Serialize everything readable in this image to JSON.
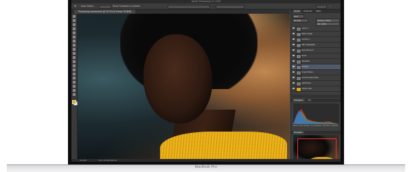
{
  "device": {
    "model_label": "MacBook Pro"
  },
  "window": {
    "title": "Adobe Photoshop CC 2018"
  },
  "document": {
    "tab_label": "Photoshop screenshot @ 33.3% (Portrait, RGB/8)"
  },
  "options_bar": {
    "tool_label": "Auto-Select",
    "select_value": "Layer",
    "transform_label": "Show Transform Controls"
  },
  "panels": {
    "tabs": [
      "Layers",
      "Channels",
      "Paths"
    ],
    "active_tab": "Layers",
    "kind_label": "Kind",
    "blend_mode": "Normal",
    "opacity_label": "Opacity: 100%",
    "fill_label": "Fill: 100%",
    "layers": [
      {
        "name": "Layer 1"
      },
      {
        "name": "Base Image"
      },
      {
        "name": "Curves 1"
      },
      {
        "name": "Skin Highlights"
      },
      {
        "name": "Hair Retouch"
      },
      {
        "name": "Hand"
      },
      {
        "name": "Shoulder"
      },
      {
        "name": "Portrait"
      },
      {
        "name": "Smart Filters"
      },
      {
        "name": "Camera Raw Filter"
      },
      {
        "name": "Add Noise"
      },
      {
        "name": "Yellow shirt"
      }
    ]
  },
  "histogram": {
    "tabs": [
      "Histogram",
      "Info"
    ],
    "stats": "Mean: 64.31  Std Dev: 51.22  Median: 48  Pixels: 1205760"
  },
  "navigator": {
    "tabs": [
      "Navigator"
    ]
  },
  "status": {
    "zoom": "33.33%",
    "doc_size": "Doc: 24.9M/182.1M"
  },
  "colors": {
    "foreground": "#e3b00c",
    "background": "#ffffff",
    "ui_dark": "#3e3e3e",
    "sweater": "#f1bb20"
  }
}
